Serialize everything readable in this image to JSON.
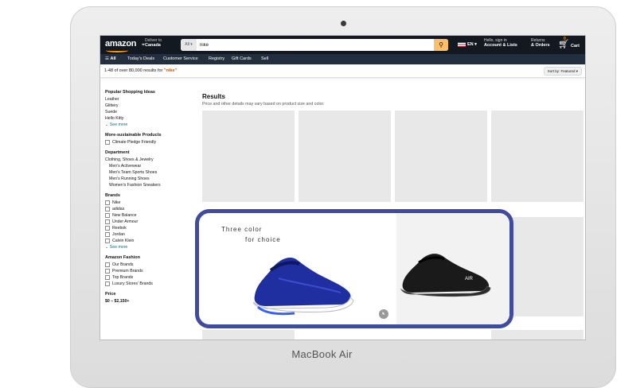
{
  "device": {
    "label": "MacBook Air"
  },
  "header": {
    "logo": "amazon",
    "deliver_line1": "Deliver to",
    "deliver_line2": "Canada",
    "search_category": "All",
    "search_value": "nike",
    "language": "EN",
    "account_line1": "Hello, sign in",
    "account_line2": "Account & Lists",
    "returns_line1": "Returns",
    "returns_line2": "& Orders",
    "cart_count": "0",
    "cart_label": "Cart"
  },
  "subnav": [
    "All",
    "Today's Deals",
    "Customer Service",
    "Registry",
    "Gift Cards",
    "Sell"
  ],
  "results_bar": {
    "count_text": "1-48 of over 80,000 results for",
    "query": "\"nike\"",
    "sort_label": "Sort by: Featured"
  },
  "sidebar": {
    "popular": {
      "title": "Popular Shopping Ideas",
      "items": [
        "Leather",
        "Glittery",
        "Suede",
        "Hello Kitty"
      ],
      "more": "See more"
    },
    "sustainable": {
      "title": "More-sustainable Products",
      "items": [
        "Climate Pledge Friendly"
      ]
    },
    "department": {
      "title": "Department",
      "items": [
        "Clothing, Shoes & Jewelry",
        "Men's Activewear",
        "Men's Team Sports Shoes",
        "Men's Running Shoes",
        "Women's Fashion Sneakers"
      ]
    },
    "brands": {
      "title": "Brands",
      "items": [
        "Nike",
        "adidas",
        "New Balance",
        "Under Armour",
        "Reebok",
        "Jordan",
        "Calvin Klein"
      ],
      "more": "See more"
    },
    "fashion": {
      "title": "Amazon Fashion",
      "items": [
        "Our Brands",
        "Premium Brands",
        "Top Brands",
        "Luxury Stores' Brands"
      ]
    },
    "price": {
      "title": "Price",
      "range": "$0 – $2,150+"
    }
  },
  "results": {
    "title": "Results",
    "subtitle": "Price and other details may vary based on product size and color."
  },
  "ad": {
    "line1": "Three color",
    "line2": "for choice",
    "shoe_brand_mark": "AIR"
  },
  "colors": {
    "nav": "#131921",
    "subnav": "#232f3e",
    "search_button": "#febd69",
    "highlight_border": "#3f4aa1",
    "shoe_blue": "#1f2fa0"
  }
}
